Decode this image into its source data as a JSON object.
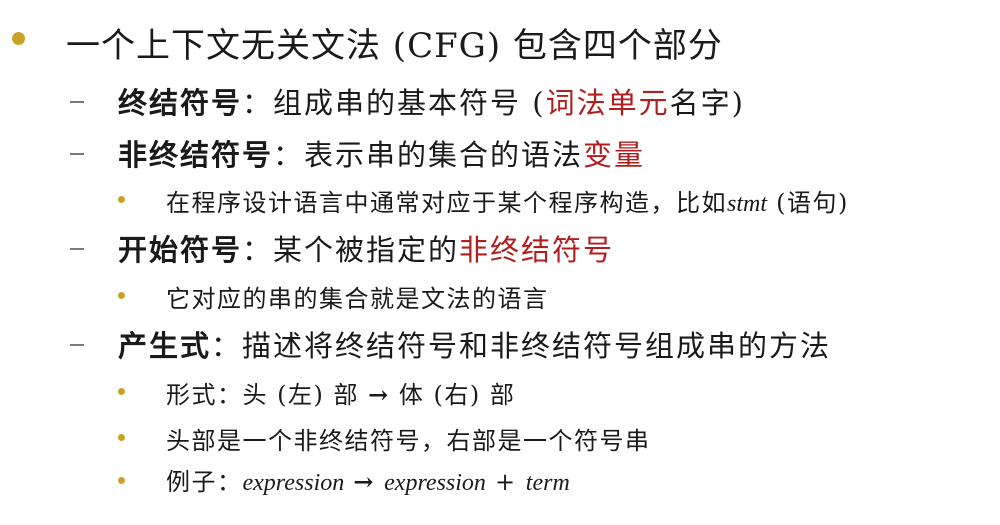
{
  "title": {
    "pre": "一个上下文无关文法 (CFG) 包含四个部分"
  },
  "items": [
    {
      "term": "终结符号",
      "sep": "：",
      "desc_pre": "组成串的基本符号 (",
      "desc_red": "词法单元",
      "desc_post": "名字)"
    },
    {
      "term": "非终结符号",
      "sep": "：",
      "desc_pre": "表示串的集合的语法",
      "desc_red": "变量",
      "sub": [
        {
          "pre": "在程序设计语言中通常对应于某个程序构造，比如",
          "italic": "stmt",
          "post": " (语句)"
        }
      ]
    },
    {
      "term": "开始符号",
      "sep": "：",
      "desc_pre": "某个被指定的",
      "desc_red": "非终结符号",
      "sub": [
        {
          "pre": "它对应的串的集合就是文法的语言"
        }
      ]
    },
    {
      "term": "产生式",
      "sep": "：",
      "desc_pre": "描述将终结符号和非终结符号组成串的方法",
      "sub": [
        {
          "pre": "形式：头 (左) 部 ",
          "arrow": "→",
          "post": " 体 (右) 部"
        },
        {
          "pre": "头部是一个非终结符号，右部是一个符号串"
        },
        {
          "pre": "例子：",
          "italic1": "expression",
          "arrow": "→",
          "italic2": "expression",
          "plus": " + ",
          "italic3": "term"
        }
      ]
    }
  ],
  "colors": {
    "bullet": "#c9a227",
    "highlight": "#b01e1e",
    "dash": "#7a7a7a"
  }
}
